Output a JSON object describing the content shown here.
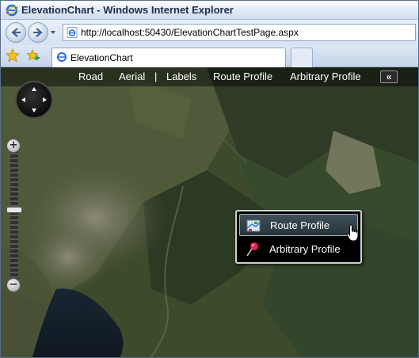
{
  "browser": {
    "title": "ElevationChart - Windows Internet Explorer",
    "url": "http://localhost:50430/ElevationChartTestPage.aspx",
    "tab_label": "ElevationChart"
  },
  "map": {
    "toolbar": {
      "road": "Road",
      "aerial": "Aerial",
      "separator": "|",
      "labels": "Labels",
      "route_profile": "Route Profile",
      "arbitrary_profile": "Arbitrary Profile",
      "collapse": "«"
    },
    "zoom": {
      "plus": "+",
      "minus": "−"
    },
    "popup": {
      "items": [
        {
          "label": "Route Profile",
          "icon": "route-map-icon",
          "hovered": true
        },
        {
          "label": "Arbitrary Profile",
          "icon": "pushpin-icon",
          "hovered": false
        }
      ]
    }
  },
  "colors": {
    "titlebar_text": "#1d2d4a",
    "map_toolbar_bg": "#000000",
    "popup_bg": "#000000",
    "popup_hover": "#3f4f58"
  }
}
